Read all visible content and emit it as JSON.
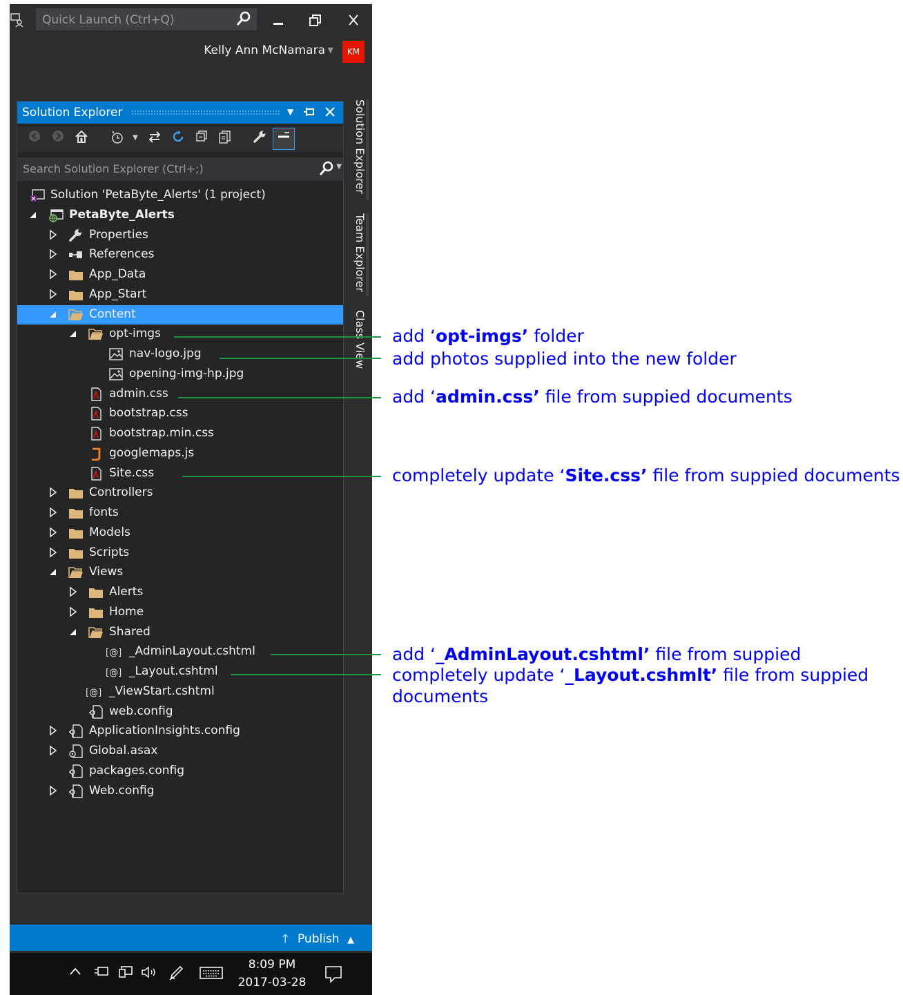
{
  "title_bar": {
    "quick_launch_placeholder": "Quick Launch (Ctrl+Q)",
    "user_name": "Kelly Ann McNamara",
    "avatar_initials": "KM",
    "avatar_color": "#e51400"
  },
  "solution_explorer": {
    "title": "Solution Explorer",
    "search_placeholder": "Search Solution Explorer (Ctrl+;)",
    "accent": "#007acc",
    "selection_color": "#3399ff",
    "items": [
      {
        "label": "Solution 'PetaByte_Alerts' (1 project)",
        "icon": "solution-icon",
        "depth": 0,
        "expander": "none",
        "bold": false,
        "selected": false
      },
      {
        "label": "PetaByte_Alerts",
        "icon": "web-project-icon",
        "depth": 0,
        "expander": "expanded",
        "bold": true,
        "selected": false
      },
      {
        "label": "Properties",
        "icon": "wrench-icon",
        "depth": 1,
        "expander": "collapsed",
        "bold": false,
        "selected": false
      },
      {
        "label": "References",
        "icon": "references-icon",
        "depth": 1,
        "expander": "collapsed",
        "bold": false,
        "selected": false
      },
      {
        "label": "App_Data",
        "icon": "folder-icon",
        "depth": 1,
        "expander": "collapsed",
        "bold": false,
        "selected": false
      },
      {
        "label": "App_Start",
        "icon": "folder-icon",
        "depth": 1,
        "expander": "collapsed",
        "bold": false,
        "selected": false
      },
      {
        "label": "Content",
        "icon": "folder-open-icon",
        "depth": 1,
        "expander": "expanded",
        "bold": false,
        "selected": true
      },
      {
        "label": "opt-imgs",
        "icon": "folder-open-icon",
        "depth": 2,
        "expander": "expanded",
        "bold": false,
        "selected": false
      },
      {
        "label": "nav-logo.jpg",
        "icon": "image-file-icon",
        "depth": 3,
        "expander": "none",
        "bold": false,
        "selected": false
      },
      {
        "label": "opening-img-hp.jpg",
        "icon": "image-file-icon",
        "depth": 3,
        "expander": "none",
        "bold": false,
        "selected": false
      },
      {
        "label": "admin.css",
        "icon": "css-file-icon",
        "depth": 2,
        "expander": "none",
        "bold": false,
        "selected": false
      },
      {
        "label": "bootstrap.css",
        "icon": "css-file-icon",
        "depth": 2,
        "expander": "none",
        "bold": false,
        "selected": false
      },
      {
        "label": "bootstrap.min.css",
        "icon": "css-file-icon",
        "depth": 2,
        "expander": "none",
        "bold": false,
        "selected": false
      },
      {
        "label": "googlemaps.js",
        "icon": "js-file-icon",
        "depth": 2,
        "expander": "none",
        "bold": false,
        "selected": false
      },
      {
        "label": "Site.css",
        "icon": "css-file-icon",
        "depth": 2,
        "expander": "none",
        "bold": false,
        "selected": false
      },
      {
        "label": "Controllers",
        "icon": "folder-icon",
        "depth": 1,
        "expander": "collapsed",
        "bold": false,
        "selected": false
      },
      {
        "label": "fonts",
        "icon": "folder-icon",
        "depth": 1,
        "expander": "collapsed",
        "bold": false,
        "selected": false
      },
      {
        "label": "Models",
        "icon": "folder-icon",
        "depth": 1,
        "expander": "collapsed",
        "bold": false,
        "selected": false
      },
      {
        "label": "Scripts",
        "icon": "folder-icon",
        "depth": 1,
        "expander": "collapsed",
        "bold": false,
        "selected": false
      },
      {
        "label": "Views",
        "icon": "folder-open-icon",
        "depth": 1,
        "expander": "expanded",
        "bold": false,
        "selected": false
      },
      {
        "label": "Alerts",
        "icon": "folder-icon",
        "depth": 2,
        "expander": "collapsed",
        "bold": false,
        "selected": false
      },
      {
        "label": "Home",
        "icon": "folder-icon",
        "depth": 2,
        "expander": "collapsed",
        "bold": false,
        "selected": false
      },
      {
        "label": "Shared",
        "icon": "folder-open-icon",
        "depth": 2,
        "expander": "expanded",
        "bold": false,
        "selected": false
      },
      {
        "label": "_AdminLayout.cshtml",
        "icon": "razor-file-icon",
        "depth": 3,
        "expander": "none",
        "bold": false,
        "selected": false
      },
      {
        "label": "_Layout.cshtml",
        "icon": "razor-file-icon",
        "depth": 3,
        "expander": "none",
        "bold": false,
        "selected": false
      },
      {
        "label": "_ViewStart.cshtml",
        "icon": "razor-file-icon",
        "depth": 2,
        "expander": "none",
        "bold": false,
        "selected": false
      },
      {
        "label": "web.config",
        "icon": "config-file-icon",
        "depth": 2,
        "expander": "none",
        "bold": false,
        "selected": false
      },
      {
        "label": "ApplicationInsights.config",
        "icon": "config-file-icon",
        "depth": 1,
        "expander": "collapsed",
        "bold": false,
        "selected": false
      },
      {
        "label": "Global.asax",
        "icon": "asax-file-icon",
        "depth": 1,
        "expander": "collapsed",
        "bold": false,
        "selected": false
      },
      {
        "label": "packages.config",
        "icon": "config-file-icon",
        "depth": 1,
        "expander": "none",
        "bold": false,
        "selected": false
      },
      {
        "label": "Web.config",
        "icon": "config-file-icon",
        "depth": 1,
        "expander": "collapsed",
        "bold": false,
        "selected": false
      }
    ]
  },
  "side_tabs": [
    "Solution Explorer",
    "Team Explorer",
    "Class View"
  ],
  "status_bar": {
    "publish_label": "Publish"
  },
  "taskbar": {
    "time": "8:09 PM",
    "date": "2017-03-28"
  },
  "annotations": {
    "color": "#0000ee",
    "leader_color": "#1a9641",
    "opt_imgs": {
      "before": "add ‘",
      "bold": "opt-imgs’",
      "after": " folder"
    },
    "photos": {
      "text": "add photos supplied into the new folder"
    },
    "admin_css": {
      "before": "add ‘",
      "bold": "admin.css’",
      "after": " file from suppied documents"
    },
    "site_css": {
      "before": "completely update ‘",
      "bold": "Site.css’",
      "after": " file from suppied documents"
    },
    "admin_layout": {
      "before": "add ‘",
      "bold": "_AdminLayout.cshtml’",
      "after": " file from suppied"
    },
    "layout": {
      "before": "completely update ‘",
      "bold": "_Layout.cshmlt’",
      "after": " file from suppied",
      "line2": "documents"
    }
  }
}
